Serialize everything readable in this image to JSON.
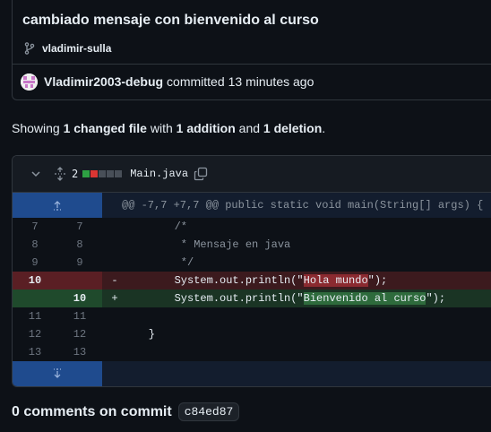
{
  "commit": {
    "title": "cambiado mensaje con bienvenido al curso",
    "branch": "vladimir-sulla",
    "author": "Vladimir2003-debug",
    "action": "committed",
    "time": "13 minutes ago"
  },
  "summary": {
    "showing": "Showing",
    "changed": "1 changed file",
    "with": "with",
    "additions": "1 addition",
    "and": "and",
    "deletions": "1 deletion",
    "period": "."
  },
  "file": {
    "count": "2",
    "name": "Main.java",
    "diffstat_colors": [
      "#2ea043",
      "#da3633",
      "#484f58",
      "#484f58",
      "#484f58"
    ],
    "hunk_header": "@@ -7,7 +7,7 @@ public static void main(String[] args) {",
    "lines": [
      {
        "old": "7",
        "new": "7",
        "sign": "",
        "code": "        /*",
        "type": "ctx"
      },
      {
        "old": "8",
        "new": "8",
        "sign": "",
        "code": "         * Mensaje en java",
        "type": "ctx"
      },
      {
        "old": "9",
        "new": "9",
        "sign": "",
        "code": "         */",
        "type": "ctx"
      },
      {
        "old": "10",
        "new": "",
        "sign": "-",
        "pre": "        System.out.println(\"",
        "hl": "Hola mundo",
        "post": "\");",
        "type": "del"
      },
      {
        "old": "",
        "new": "10",
        "sign": "+",
        "pre": "        System.out.println(\"",
        "hl": "Bienvenido al curso",
        "post": "\");",
        "type": "add"
      },
      {
        "old": "11",
        "new": "11",
        "sign": "",
        "code": "",
        "type": "ctx"
      },
      {
        "old": "12",
        "new": "12",
        "sign": "",
        "code": "    }",
        "type": "ctx"
      },
      {
        "old": "13",
        "new": "13",
        "sign": "",
        "code": "",
        "type": "ctx"
      }
    ]
  },
  "comments": {
    "label": "0 comments on commit",
    "sha": "c84ed87"
  }
}
